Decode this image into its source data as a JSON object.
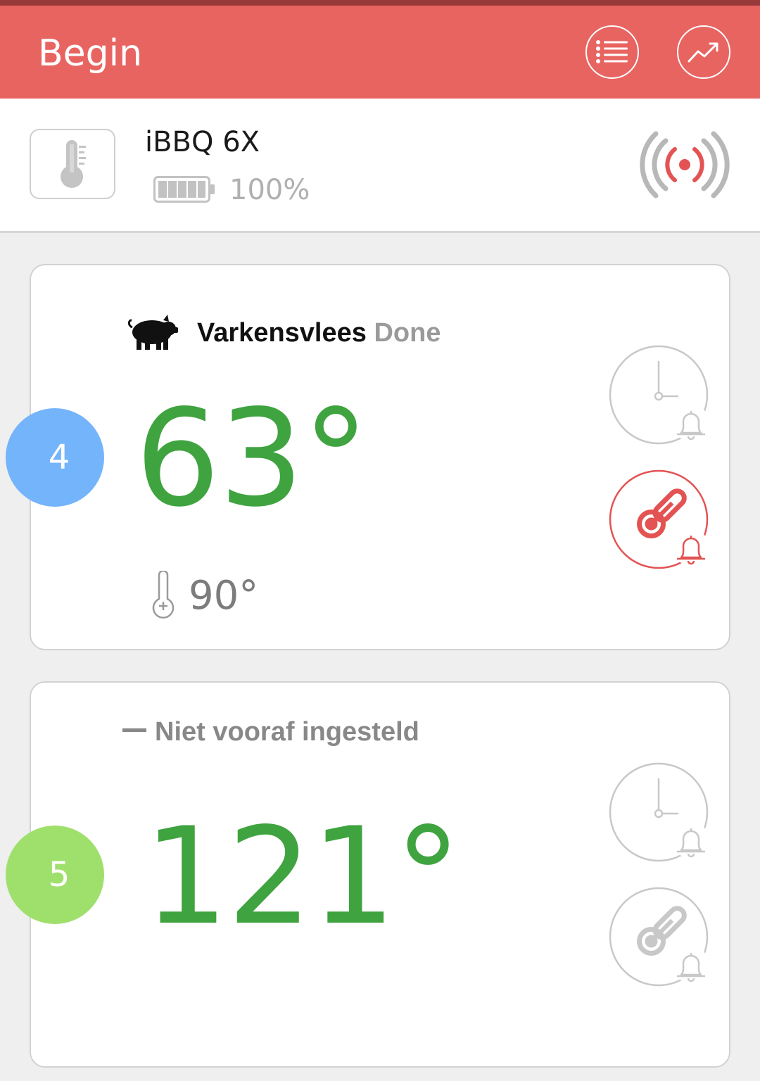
{
  "header": {
    "title": "Begin",
    "list_icon": "list-icon",
    "chart_icon": "trend-chart-icon"
  },
  "device": {
    "name": "iBBQ 6X",
    "battery_percent": "100%",
    "battery_level": 1.0,
    "icon": "thermometer-icon",
    "signal_icon": "alarm-signal-icon"
  },
  "probes": [
    {
      "number": "4",
      "badge_color": "#73b4fb",
      "meat_icon": "pig-icon",
      "meat_name": "Varkensvlees",
      "doneness": "Done",
      "current_temp": "63°",
      "target_temp": "90°",
      "timer_alarm_active": false,
      "temp_alarm_active": true
    },
    {
      "number": "5",
      "badge_color": "#9fe06d",
      "preset_label": "Niet vooraf ingesteld",
      "current_temp": "121°",
      "timer_alarm_active": false,
      "temp_alarm_active": false
    }
  ],
  "colors": {
    "accent": "#e86461",
    "temp_green": "#3fa33f",
    "alarm_red": "#e35353",
    "inactive_gray": "#c8c8c8"
  }
}
